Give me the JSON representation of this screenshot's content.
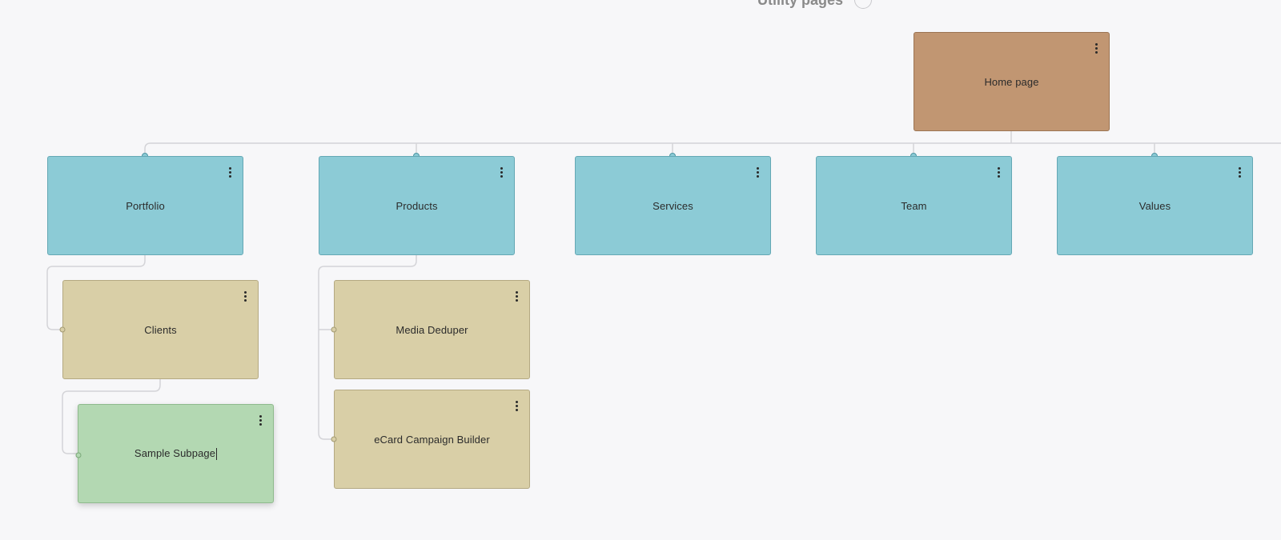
{
  "utility_pages": {
    "label": "Utility pages"
  },
  "colors": {
    "home": "#c19672",
    "level1": "#8ccbd6",
    "level2": "#d9cfa7",
    "level3": "#b3d8b2",
    "connector": "#d4d4d8"
  },
  "sitemap": {
    "home": {
      "label": "Home page"
    },
    "portfolio": {
      "label": "Portfolio"
    },
    "products": {
      "label": "Products"
    },
    "services": {
      "label": "Services"
    },
    "team": {
      "label": "Team"
    },
    "values": {
      "label": "Values"
    },
    "clients": {
      "label": "Clients"
    },
    "media_deduper": {
      "label": "Media Deduper"
    },
    "ecard_builder": {
      "label": "eCard Campaign Builder"
    },
    "sample_subpage": {
      "label": "Sample Subpage"
    }
  }
}
